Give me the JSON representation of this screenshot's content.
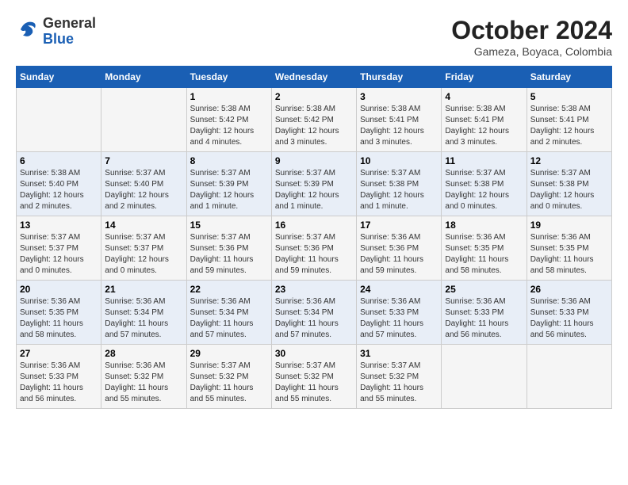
{
  "header": {
    "logo_general": "General",
    "logo_blue": "Blue",
    "month": "October 2024",
    "location": "Gameza, Boyaca, Colombia"
  },
  "days_of_week": [
    "Sunday",
    "Monday",
    "Tuesday",
    "Wednesday",
    "Thursday",
    "Friday",
    "Saturday"
  ],
  "weeks": [
    [
      {
        "day": "",
        "sunrise": "",
        "sunset": "",
        "daylight": ""
      },
      {
        "day": "",
        "sunrise": "",
        "sunset": "",
        "daylight": ""
      },
      {
        "day": "1",
        "sunrise": "Sunrise: 5:38 AM",
        "sunset": "Sunset: 5:42 PM",
        "daylight": "Daylight: 12 hours and 4 minutes."
      },
      {
        "day": "2",
        "sunrise": "Sunrise: 5:38 AM",
        "sunset": "Sunset: 5:42 PM",
        "daylight": "Daylight: 12 hours and 3 minutes."
      },
      {
        "day": "3",
        "sunrise": "Sunrise: 5:38 AM",
        "sunset": "Sunset: 5:41 PM",
        "daylight": "Daylight: 12 hours and 3 minutes."
      },
      {
        "day": "4",
        "sunrise": "Sunrise: 5:38 AM",
        "sunset": "Sunset: 5:41 PM",
        "daylight": "Daylight: 12 hours and 3 minutes."
      },
      {
        "day": "5",
        "sunrise": "Sunrise: 5:38 AM",
        "sunset": "Sunset: 5:41 PM",
        "daylight": "Daylight: 12 hours and 2 minutes."
      }
    ],
    [
      {
        "day": "6",
        "sunrise": "Sunrise: 5:38 AM",
        "sunset": "Sunset: 5:40 PM",
        "daylight": "Daylight: 12 hours and 2 minutes."
      },
      {
        "day": "7",
        "sunrise": "Sunrise: 5:37 AM",
        "sunset": "Sunset: 5:40 PM",
        "daylight": "Daylight: 12 hours and 2 minutes."
      },
      {
        "day": "8",
        "sunrise": "Sunrise: 5:37 AM",
        "sunset": "Sunset: 5:39 PM",
        "daylight": "Daylight: 12 hours and 1 minute."
      },
      {
        "day": "9",
        "sunrise": "Sunrise: 5:37 AM",
        "sunset": "Sunset: 5:39 PM",
        "daylight": "Daylight: 12 hours and 1 minute."
      },
      {
        "day": "10",
        "sunrise": "Sunrise: 5:37 AM",
        "sunset": "Sunset: 5:38 PM",
        "daylight": "Daylight: 12 hours and 1 minute."
      },
      {
        "day": "11",
        "sunrise": "Sunrise: 5:37 AM",
        "sunset": "Sunset: 5:38 PM",
        "daylight": "Daylight: 12 hours and 0 minutes."
      },
      {
        "day": "12",
        "sunrise": "Sunrise: 5:37 AM",
        "sunset": "Sunset: 5:38 PM",
        "daylight": "Daylight: 12 hours and 0 minutes."
      }
    ],
    [
      {
        "day": "13",
        "sunrise": "Sunrise: 5:37 AM",
        "sunset": "Sunset: 5:37 PM",
        "daylight": "Daylight: 12 hours and 0 minutes."
      },
      {
        "day": "14",
        "sunrise": "Sunrise: 5:37 AM",
        "sunset": "Sunset: 5:37 PM",
        "daylight": "Daylight: 12 hours and 0 minutes."
      },
      {
        "day": "15",
        "sunrise": "Sunrise: 5:37 AM",
        "sunset": "Sunset: 5:36 PM",
        "daylight": "Daylight: 11 hours and 59 minutes."
      },
      {
        "day": "16",
        "sunrise": "Sunrise: 5:37 AM",
        "sunset": "Sunset: 5:36 PM",
        "daylight": "Daylight: 11 hours and 59 minutes."
      },
      {
        "day": "17",
        "sunrise": "Sunrise: 5:36 AM",
        "sunset": "Sunset: 5:36 PM",
        "daylight": "Daylight: 11 hours and 59 minutes."
      },
      {
        "day": "18",
        "sunrise": "Sunrise: 5:36 AM",
        "sunset": "Sunset: 5:35 PM",
        "daylight": "Daylight: 11 hours and 58 minutes."
      },
      {
        "day": "19",
        "sunrise": "Sunrise: 5:36 AM",
        "sunset": "Sunset: 5:35 PM",
        "daylight": "Daylight: 11 hours and 58 minutes."
      }
    ],
    [
      {
        "day": "20",
        "sunrise": "Sunrise: 5:36 AM",
        "sunset": "Sunset: 5:35 PM",
        "daylight": "Daylight: 11 hours and 58 minutes."
      },
      {
        "day": "21",
        "sunrise": "Sunrise: 5:36 AM",
        "sunset": "Sunset: 5:34 PM",
        "daylight": "Daylight: 11 hours and 57 minutes."
      },
      {
        "day": "22",
        "sunrise": "Sunrise: 5:36 AM",
        "sunset": "Sunset: 5:34 PM",
        "daylight": "Daylight: 11 hours and 57 minutes."
      },
      {
        "day": "23",
        "sunrise": "Sunrise: 5:36 AM",
        "sunset": "Sunset: 5:34 PM",
        "daylight": "Daylight: 11 hours and 57 minutes."
      },
      {
        "day": "24",
        "sunrise": "Sunrise: 5:36 AM",
        "sunset": "Sunset: 5:33 PM",
        "daylight": "Daylight: 11 hours and 57 minutes."
      },
      {
        "day": "25",
        "sunrise": "Sunrise: 5:36 AM",
        "sunset": "Sunset: 5:33 PM",
        "daylight": "Daylight: 11 hours and 56 minutes."
      },
      {
        "day": "26",
        "sunrise": "Sunrise: 5:36 AM",
        "sunset": "Sunset: 5:33 PM",
        "daylight": "Daylight: 11 hours and 56 minutes."
      }
    ],
    [
      {
        "day": "27",
        "sunrise": "Sunrise: 5:36 AM",
        "sunset": "Sunset: 5:33 PM",
        "daylight": "Daylight: 11 hours and 56 minutes."
      },
      {
        "day": "28",
        "sunrise": "Sunrise: 5:36 AM",
        "sunset": "Sunset: 5:32 PM",
        "daylight": "Daylight: 11 hours and 55 minutes."
      },
      {
        "day": "29",
        "sunrise": "Sunrise: 5:37 AM",
        "sunset": "Sunset: 5:32 PM",
        "daylight": "Daylight: 11 hours and 55 minutes."
      },
      {
        "day": "30",
        "sunrise": "Sunrise: 5:37 AM",
        "sunset": "Sunset: 5:32 PM",
        "daylight": "Daylight: 11 hours and 55 minutes."
      },
      {
        "day": "31",
        "sunrise": "Sunrise: 5:37 AM",
        "sunset": "Sunset: 5:32 PM",
        "daylight": "Daylight: 11 hours and 55 minutes."
      },
      {
        "day": "",
        "sunrise": "",
        "sunset": "",
        "daylight": ""
      },
      {
        "day": "",
        "sunrise": "",
        "sunset": "",
        "daylight": ""
      }
    ]
  ]
}
